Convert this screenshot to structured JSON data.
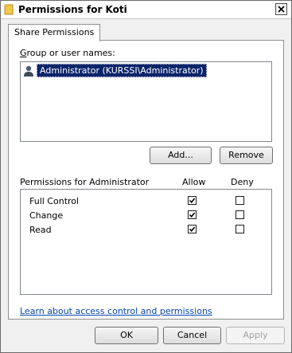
{
  "window": {
    "title": "Permissions for Koti",
    "close_symbol": "✕"
  },
  "tab": {
    "label": "Share Permissions"
  },
  "groups": {
    "label": "Group or user names:",
    "items": [
      {
        "name": "Administrator (KURSSI\\Administrator)",
        "icon": "user-icon",
        "selected": true
      }
    ]
  },
  "buttons": {
    "add": "Add...",
    "remove": "Remove",
    "ok": "OK",
    "cancel": "Cancel",
    "apply": "Apply"
  },
  "permissions": {
    "label": "Permissions for Administrator",
    "allow_header": "Allow",
    "deny_header": "Deny",
    "rows": [
      {
        "name": "Full Control",
        "allow": true,
        "deny": false
      },
      {
        "name": "Change",
        "allow": true,
        "deny": false
      },
      {
        "name": "Read",
        "allow": true,
        "deny": false
      }
    ]
  },
  "link": {
    "text": "Learn about access control and permissions"
  },
  "colors": {
    "selection": "#0a246a",
    "link": "#0645ad"
  }
}
